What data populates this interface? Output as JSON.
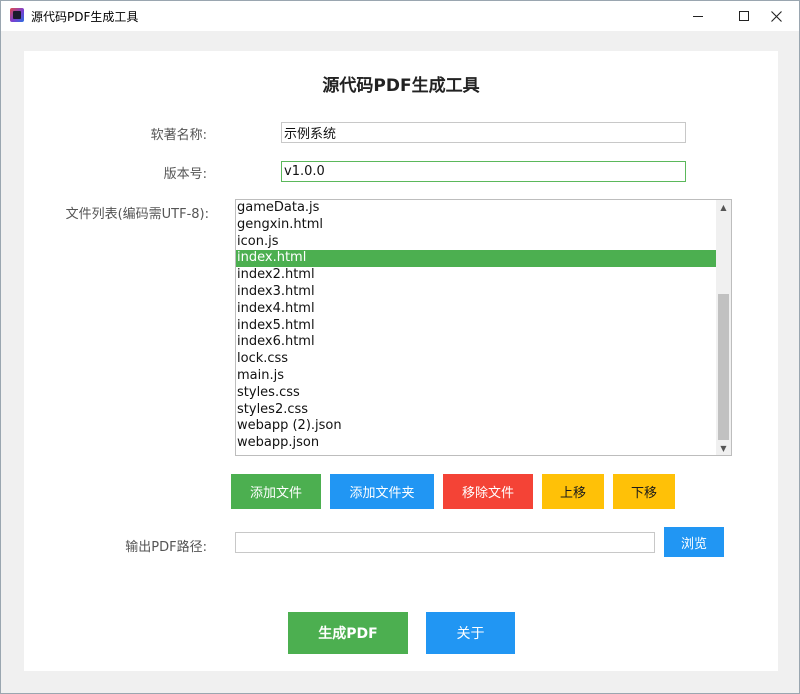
{
  "window": {
    "title": "源代码PDF生成工具"
  },
  "heading": "源代码PDF生成工具",
  "form": {
    "software_name_label": "软著名称:",
    "software_name_value": "示例系统",
    "version_label": "版本号:",
    "version_value": "v1.0.0",
    "file_list_label": "文件列表(编码需UTF-8):",
    "output_label": "输出PDF路径:",
    "output_value": ""
  },
  "files": {
    "items": [
      "gameData.js",
      "gengxin.html",
      "icon.js",
      "index.html",
      "index2.html",
      "index3.html",
      "index4.html",
      "index5.html",
      "index6.html",
      "lock.css",
      "main.js",
      "styles.css",
      "styles2.css",
      "webapp (2).json",
      "webapp.json"
    ],
    "selected_index": 3
  },
  "buttons": {
    "add_file": "添加文件",
    "add_folder": "添加文件夹",
    "remove_file": "移除文件",
    "move_up": "上移",
    "move_down": "下移",
    "browse": "浏览",
    "generate": "生成PDF",
    "about": "关于"
  },
  "icons": {
    "app": "app-icon",
    "minimize": "minimize-icon",
    "maximize": "maximize-icon",
    "close": "close-icon",
    "scroll_up": "scroll-up-arrow-icon",
    "scroll_down": "scroll-down-arrow-icon"
  },
  "colors": {
    "green": "#4caf50",
    "blue": "#2196f3",
    "red": "#f44336",
    "amber": "#ffc107"
  }
}
